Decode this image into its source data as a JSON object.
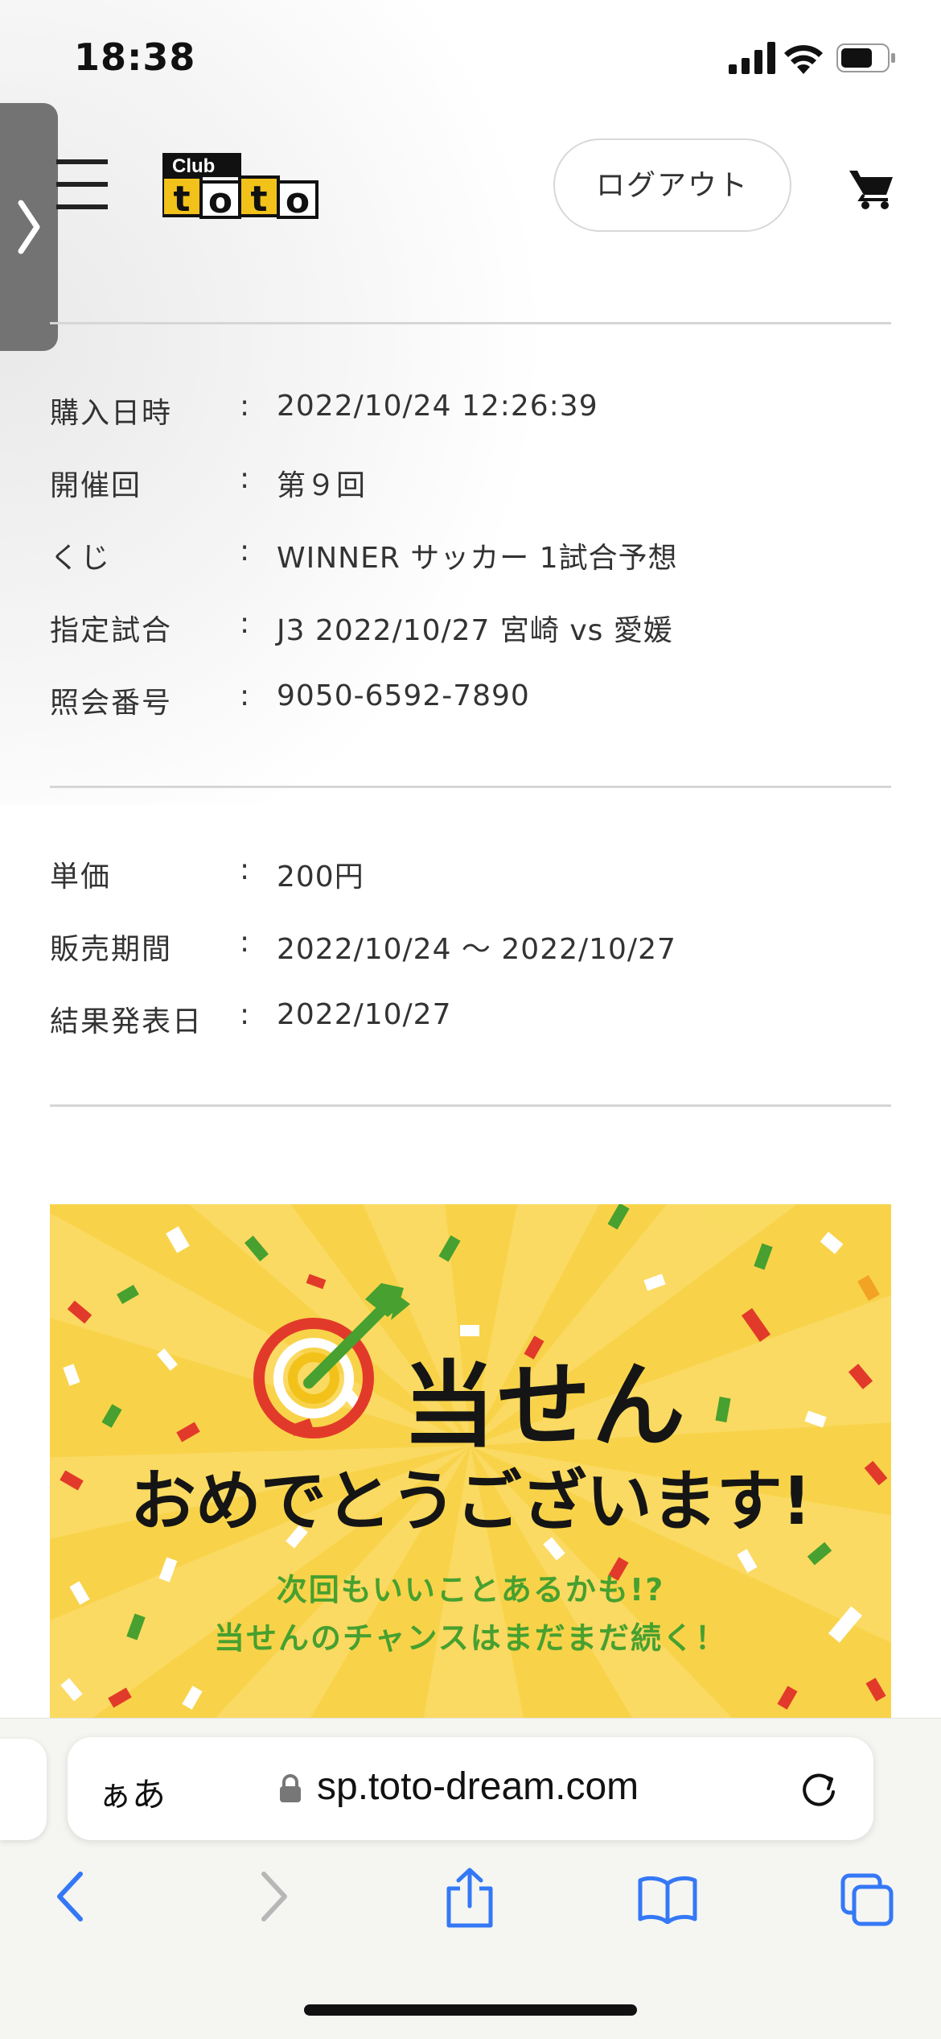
{
  "status_bar": {
    "time": "18:38"
  },
  "header": {
    "logo_alt": "Club toto",
    "logout_label": "ログアウト"
  },
  "purchase_info": [
    {
      "label": "購入日時",
      "colon": ":",
      "value": "2022/10/24 12:26:39"
    },
    {
      "label": "開催回",
      "colon": ":",
      "value": "第９回"
    },
    {
      "label": "くじ",
      "colon": ":",
      "value": "WINNER サッカー 1試合予想"
    },
    {
      "label": "指定試合",
      "colon": ":",
      "value": "J3 2022/10/27 宮崎 vs 愛媛"
    },
    {
      "label": "照会番号",
      "colon": ":",
      "value": "9050-6592-7890"
    }
  ],
  "price_info": [
    {
      "label": "単価",
      "colon": ":",
      "value": "200円"
    },
    {
      "label": "販売期間",
      "colon": ":",
      "value": "2022/10/24 〜 2022/10/27"
    },
    {
      "label": "結果発表日",
      "colon": ":",
      "value": "2022/10/27"
    }
  ],
  "banner": {
    "title": "当せん",
    "subtitle": "おめでとうございます!",
    "line1": "次回もいいことあるかも!?",
    "line2": "当せんのチャンスはまだまだ続く！",
    "colors": {
      "background": "#f8d34a",
      "accent_green": "#47a02f",
      "target_red": "#e23a2a"
    }
  },
  "browser": {
    "aa_label": "ぁあ",
    "url": "sp.toto-dream.com",
    "accent": "#3478f6"
  }
}
